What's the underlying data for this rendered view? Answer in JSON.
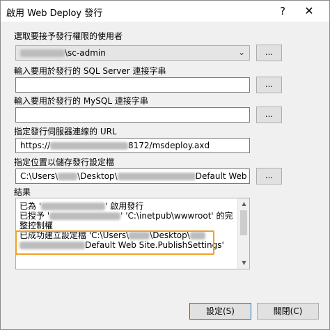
{
  "window": {
    "title": "啟用 Web Deploy 發行",
    "help_label": "?",
    "close_label": "✕"
  },
  "publish_user": {
    "label": "選取要接予發行權限的使用者",
    "value_suffix": "\\sc-admin",
    "browse_label": "..."
  },
  "sql_server": {
    "label": "輸入要用於發行的 SQL Server 連接字串",
    "value": "",
    "browse_label": "..."
  },
  "mysql": {
    "label": "輸入要用於發行的 MySQL 連接字串",
    "value": "",
    "browse_label": "..."
  },
  "server_url": {
    "label": "指定發行伺服器連線的 URL",
    "value_prefix": "https://",
    "value_suffix": "8172/msdeploy.axd"
  },
  "settings_file": {
    "label": "指定位置以儲存發行設定檔",
    "value_prefix": "C:\\Users\\",
    "value_mid": "\\Desktop\\",
    "value_suffix": "Default Web",
    "browse_label": "..."
  },
  "results": {
    "label": "結果",
    "line1_prefix": "已為 '",
    "line1_suffix": "' 啟用發行",
    "line2_prefix": "已授予 '",
    "line2_suffix": "' 'C:\\inetpub\\wwwroot' 的完",
    "line3": "整控制權",
    "line4_prefix": "已成功建立設定檔 'C:\\Users\\",
    "line4_suffix": "\\Desktop\\",
    "line5": "Default Web Site.PublishSettings'"
  },
  "buttons": {
    "ok_label": "設定(S)",
    "close_label": "關閉(C)"
  },
  "colors": {
    "highlight": "#f2a022",
    "default_button_border": "#0078d7"
  }
}
